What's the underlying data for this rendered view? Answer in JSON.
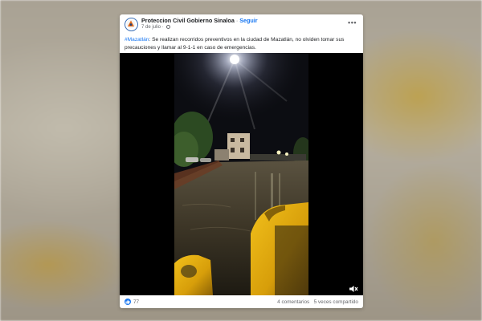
{
  "post": {
    "page_name": "Proteccion Civil Gobierno Sinaloa",
    "separator": "·",
    "follow_label": "Seguir",
    "date": "7 de julio",
    "date_separator": "·",
    "more_icon": "more-horizontal-icon",
    "privacy_icon": "globe-icon",
    "caption_hashtag": "#Mazatlán",
    "caption_text": ": Se realizan recorridos preventivos en la ciudad de Mazatlán, no olviden tomar sus precauciones y llamar al 9-1-1 en caso de emergencias."
  },
  "video": {
    "mute_icon": "volume-muted-icon"
  },
  "footer": {
    "like_icon": "thumbs-up-icon",
    "like_count": "77",
    "comments": "4 comentarios",
    "shares": "5 veces compartido"
  },
  "colors": {
    "brand_blue": "#1877f2",
    "text_primary": "#1c1e21",
    "text_secondary": "#65676b"
  }
}
